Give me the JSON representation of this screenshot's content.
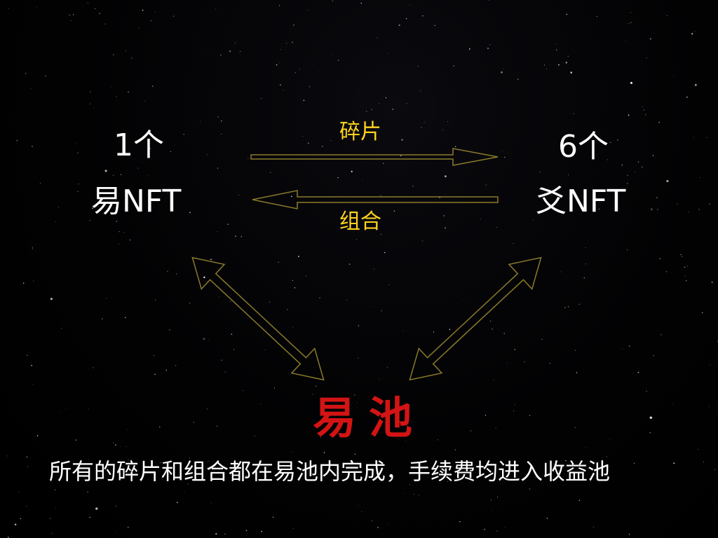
{
  "colors": {
    "background": "#000000",
    "main_text": "#ffffff",
    "arrow_label": "#ffd21f",
    "arrow_outline": "#8a7a2a",
    "pool_title": "#d41414"
  },
  "left_node": {
    "count": "1个",
    "name": "易NFT"
  },
  "right_node": {
    "count": "6个",
    "name": "爻NFT"
  },
  "arrows": {
    "top_label": "碎片",
    "bottom_label": "组合"
  },
  "pool": {
    "title": "易池"
  },
  "caption": "所有的碎片和组合都在易池内完成，手续费均进入收益池"
}
